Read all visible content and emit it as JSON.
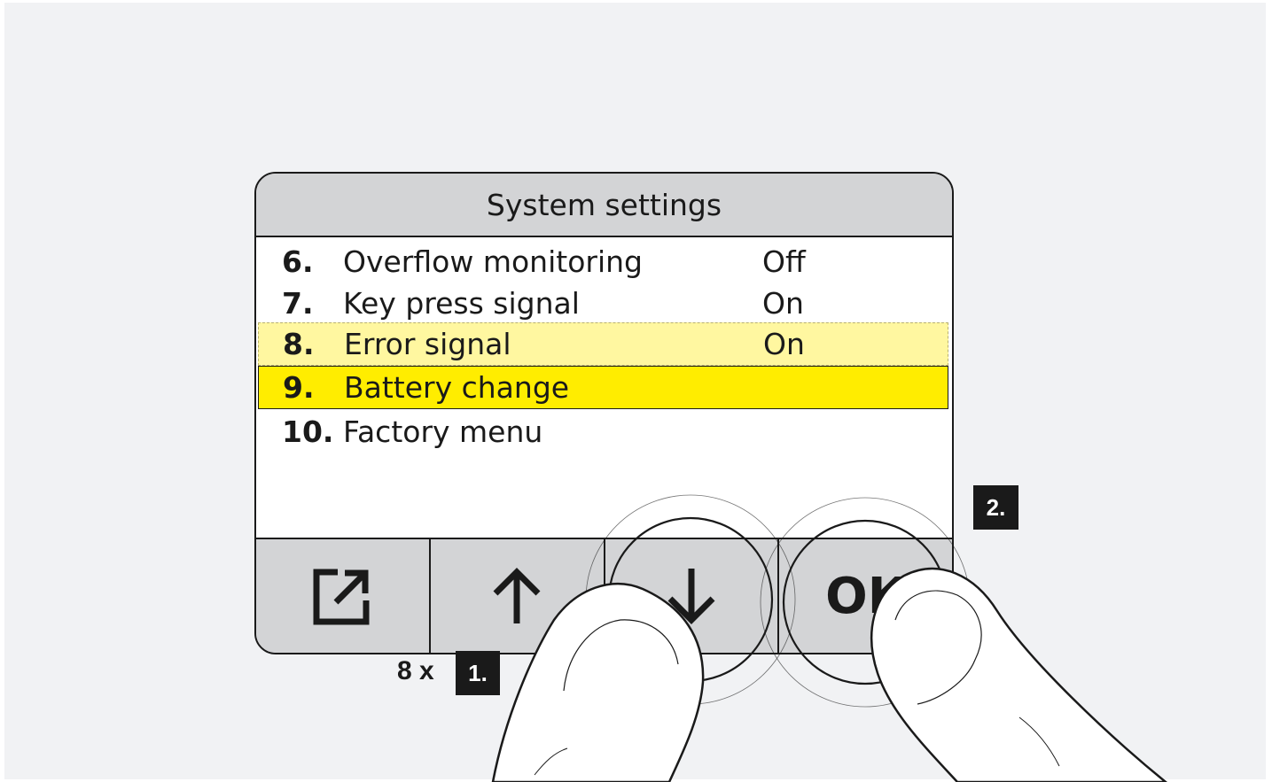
{
  "screen": {
    "title": "System settings",
    "rows": [
      {
        "num": "6.",
        "label": "Overflow monitoring",
        "value": "Off"
      },
      {
        "num": "7.",
        "label": "Key press signal",
        "value": "On"
      },
      {
        "num": "8.",
        "label": "Error signal",
        "value": "On"
      },
      {
        "num": "9.",
        "label": "Battery change",
        "value": ""
      },
      {
        "num": "10.",
        "label": "Factory menu",
        "value": ""
      }
    ]
  },
  "soft_keys": [
    {
      "icon": "exit-icon"
    },
    {
      "icon": "arrow-up-icon"
    },
    {
      "icon": "arrow-down-icon"
    },
    {
      "label": "OK"
    }
  ],
  "steps": {
    "step1_label": "1.",
    "step1_repeat": "8 x",
    "step2_label": "2."
  },
  "colors": {
    "highlight_selected": "#ffed00",
    "highlight_previous": "#fff7a0",
    "panel_gray": "#d3d4d6",
    "background": "#f1f2f4"
  }
}
